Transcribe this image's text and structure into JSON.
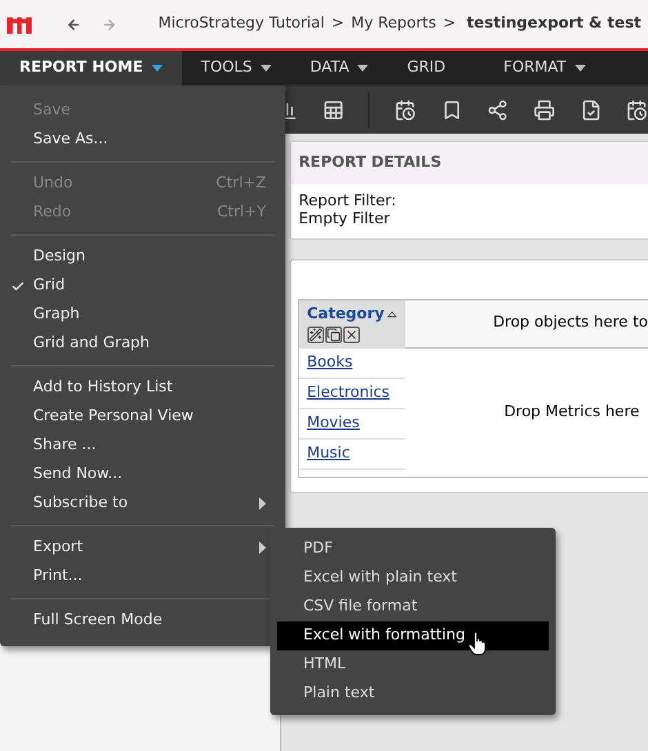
{
  "breadcrumb": {
    "items": [
      "MicroStrategy Tutorial",
      "My Reports"
    ],
    "separator": ">",
    "current": "testingexport & test"
  },
  "menu_bar": [
    {
      "label": "REPORT HOME",
      "selected": true,
      "has_caret": true
    },
    {
      "label": "TOOLS",
      "selected": false,
      "has_caret": true
    },
    {
      "label": "DATA",
      "selected": false,
      "has_caret": true
    },
    {
      "label": "GRID",
      "selected": false,
      "has_caret": false
    },
    {
      "label": "FORMAT",
      "selected": false,
      "has_caret": true
    }
  ],
  "report_details": {
    "title": "REPORT DETAILS",
    "lines": [
      "Report Filter:",
      "Empty Filter"
    ]
  },
  "grid": {
    "header": "Category",
    "column_drop_hint": "Drop objects here to",
    "metrics_drop_hint": "Drop Metrics here",
    "rows": [
      "Books",
      "Electronics",
      "Movies",
      "Music"
    ]
  },
  "menu_sections": [
    [
      {
        "label": "Save",
        "disabled": true,
        "checked": false,
        "has_submenu": false
      },
      {
        "label": "Save As...",
        "disabled": false,
        "checked": false,
        "has_submenu": false
      }
    ],
    [
      {
        "label": "Undo",
        "shortcut": "Ctrl+Z",
        "disabled": true,
        "checked": false,
        "has_submenu": false
      },
      {
        "label": "Redo",
        "shortcut": "Ctrl+Y",
        "disabled": true,
        "checked": false,
        "has_submenu": false
      }
    ],
    [
      {
        "label": "Design",
        "disabled": false,
        "checked": false,
        "has_submenu": false
      },
      {
        "label": "Grid",
        "disabled": false,
        "checked": true,
        "has_submenu": false
      },
      {
        "label": "Graph",
        "disabled": false,
        "checked": false,
        "has_submenu": false
      },
      {
        "label": "Grid and Graph",
        "disabled": false,
        "checked": false,
        "has_submenu": false
      }
    ],
    [
      {
        "label": "Add to History List",
        "disabled": false,
        "checked": false,
        "has_submenu": false
      },
      {
        "label": "Create Personal View",
        "disabled": false,
        "checked": false,
        "has_submenu": false
      },
      {
        "label": "Share ...",
        "disabled": false,
        "checked": false,
        "has_submenu": false
      },
      {
        "label": "Send Now...",
        "disabled": false,
        "checked": false,
        "has_submenu": false
      },
      {
        "label": "Subscribe to",
        "disabled": false,
        "checked": false,
        "has_submenu": true
      }
    ],
    [
      {
        "label": "Export",
        "disabled": false,
        "checked": false,
        "has_submenu": true
      },
      {
        "label": "Print...",
        "disabled": false,
        "checked": false,
        "has_submenu": false
      }
    ],
    [
      {
        "label": "Full Screen Mode",
        "disabled": false,
        "checked": false,
        "has_submenu": false
      }
    ]
  ],
  "export_submenu": [
    {
      "label": "PDF",
      "selected": false
    },
    {
      "label": "Excel with plain text",
      "selected": false
    },
    {
      "label": "CSV file format",
      "selected": false
    },
    {
      "label": "Excel with formatting",
      "selected": true
    },
    {
      "label": "HTML",
      "selected": false
    },
    {
      "label": "Plain text",
      "selected": false
    }
  ]
}
